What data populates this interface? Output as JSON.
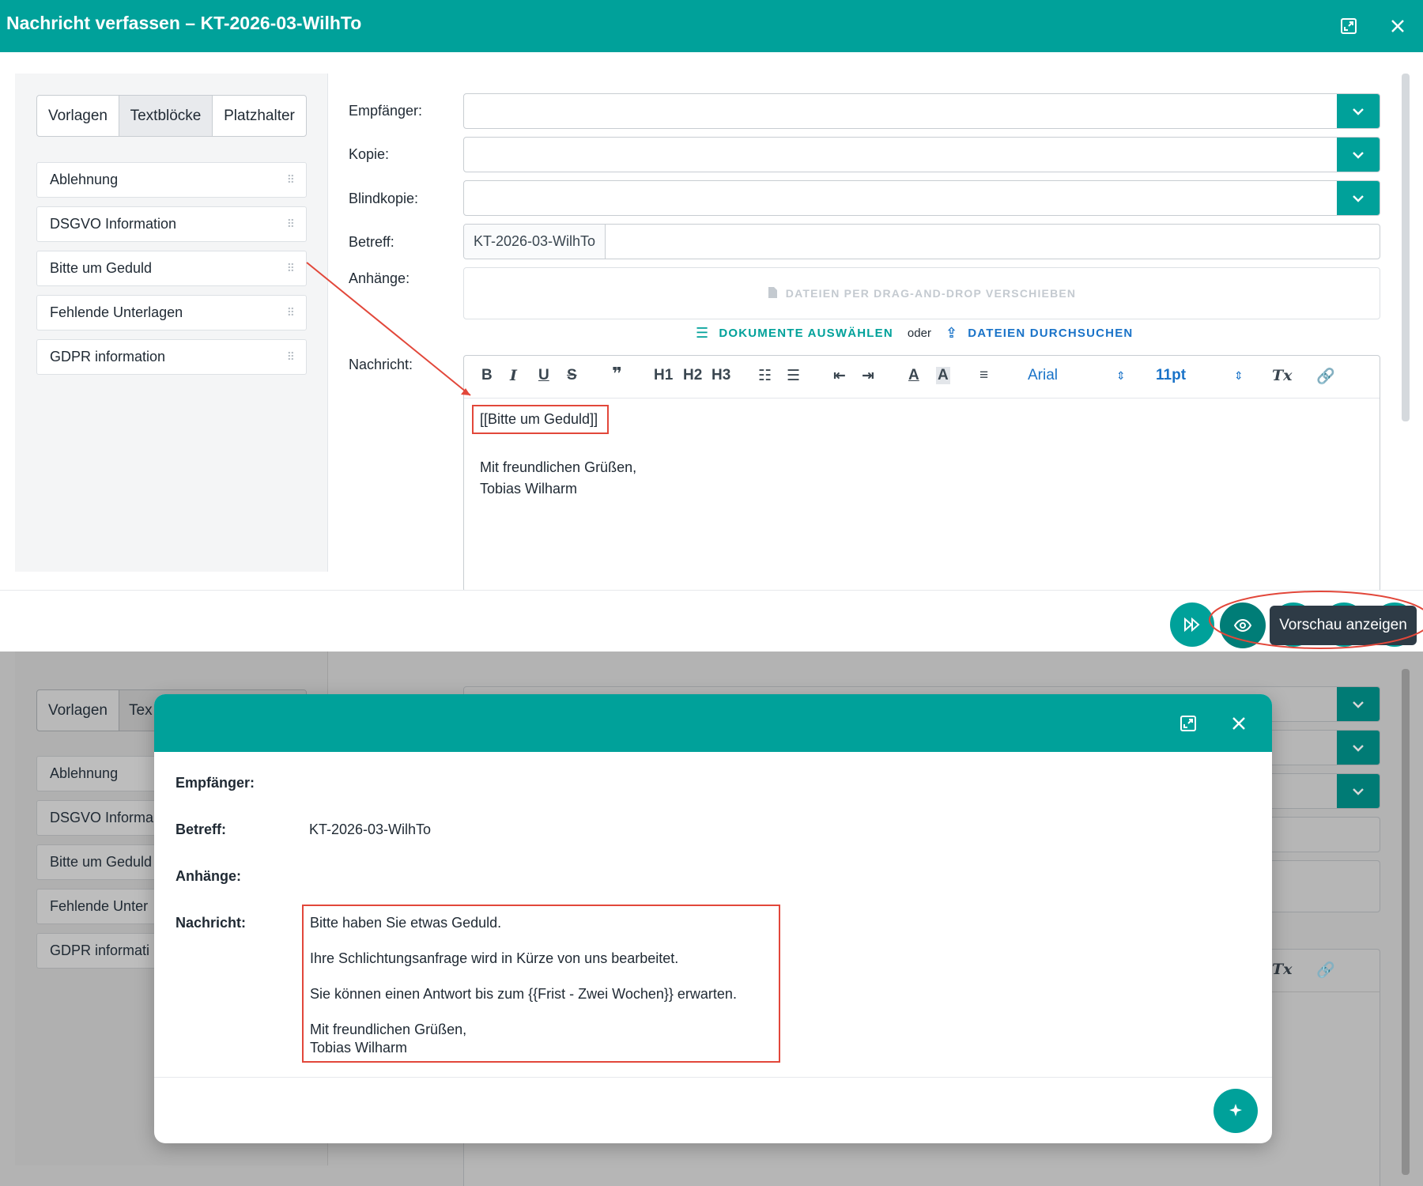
{
  "window": {
    "title": "Nachricht verfassen – KT-2026-03-WilhTo"
  },
  "sidebar": {
    "tabs": [
      {
        "label": "Vorlagen"
      },
      {
        "label": "Textblöcke"
      },
      {
        "label": "Platzhalter"
      }
    ],
    "items": [
      {
        "label": "Ablehnung"
      },
      {
        "label": "DSGVO Information"
      },
      {
        "label": "Bitte um Geduld"
      },
      {
        "label": "Fehlende Unterlagen"
      },
      {
        "label": "GDPR information"
      }
    ],
    "truncated_items": [
      {
        "label": "Ablehnung"
      },
      {
        "label": "DSGVO Informa"
      },
      {
        "label": "Bitte um Geduld"
      },
      {
        "label": "Fehlende Unter"
      },
      {
        "label": "GDPR informati"
      }
    ],
    "truncated_tab": "Tex"
  },
  "form": {
    "recipient_label": "Empfänger:",
    "cc_label": "Kopie:",
    "bcc_label": "Blindkopie:",
    "subject_label": "Betreff:",
    "subject_prefix": "KT-2026-03-WilhTo",
    "attachments_label": "Anhänge:",
    "dropzone_text": "DATEIEN PER DRAG-AND-DROP VERSCHIEBEN",
    "select_documents": "DOKUMENTE AUSWÄHLEN",
    "or_text": "oder",
    "browse_files": "DATEIEN DURCHSUCHEN",
    "message_label": "Nachricht:"
  },
  "toolbar": {
    "bold": "B",
    "italic": "I",
    "underline": "U",
    "strike": "S",
    "quote": "99",
    "h1": "H1",
    "h2": "H2",
    "h3": "H3",
    "font": "Arial",
    "size": "11pt",
    "clear_format": "Tx"
  },
  "editor": {
    "placeholder_block": "[[Bitte um Geduld]]",
    "closing": "Mit freundlichen Grüßen,",
    "signature": "Tobias Wilharm"
  },
  "actions": {
    "tooltip": "Vorschau anzeigen"
  },
  "preview": {
    "recipient_label": "Empfänger:",
    "subject_label": "Betreff:",
    "subject_value": "KT-2026-03-WilhTo",
    "attachments_label": "Anhänge:",
    "message_label": "Nachricht:",
    "message_lines": [
      "Bitte haben Sie etwas Geduld.",
      "Ihre Schlichtungsanfrage wird in Kürze von uns bearbeitet.",
      "Sie können einen Antwort bis zum {{Frist - Zwei Wochen}} erwarten.",
      "Mit freundlichen Grüßen,",
      "Tobias Wilharm"
    ]
  },
  "colors": {
    "accent": "#00a19a",
    "highlight": "#e2473a",
    "link": "#1a73c8"
  }
}
